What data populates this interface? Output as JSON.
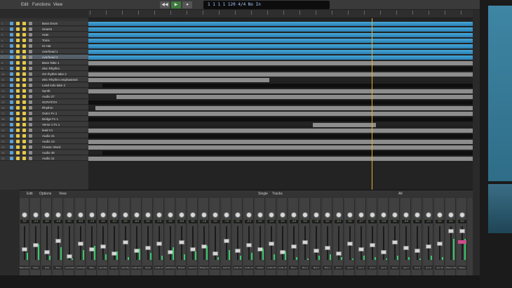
{
  "menu": {
    "edit": "Edit",
    "functions": "Functions",
    "view": "View"
  },
  "lcd": {
    "text": "1 1 1 1   120   4/4   No In"
  },
  "tracks": [
    {
      "num": "1",
      "name": "Bass Drum"
    },
    {
      "num": "2",
      "name": "Snares"
    },
    {
      "num": "3",
      "name": "Hats"
    },
    {
      "num": "4",
      "name": "Toms"
    },
    {
      "num": "5",
      "name": "Hi Hat"
    },
    {
      "num": "6",
      "name": "overhead 1"
    },
    {
      "num": "7",
      "name": "overhead 2"
    },
    {
      "num": "8",
      "name": "Bass Take 1"
    },
    {
      "num": "9",
      "name": "elec Rhythm"
    },
    {
      "num": "10",
      "name": "Gtr rhythm take 2"
    },
    {
      "num": "11",
      "name": "elec Rhythm emphasised"
    },
    {
      "num": "12",
      "name": "Lead solo take 2"
    },
    {
      "num": "13",
      "name": "Synth"
    },
    {
      "num": "14",
      "name": "Audio 27"
    },
    {
      "num": "15",
      "name": "SCRATCH"
    },
    {
      "num": "16",
      "name": "Rhythm"
    },
    {
      "num": "17",
      "name": "Outro Fx 1"
    },
    {
      "num": "18",
      "name": "Bridge Fx 1"
    },
    {
      "num": "19",
      "name": "Verse 1 Fx 1"
    },
    {
      "num": "20",
      "name": "lead V1"
    },
    {
      "num": "21",
      "name": "Audio 41"
    },
    {
      "num": "22",
      "name": "Audio 13"
    },
    {
      "num": "23",
      "name": "Classic Word"
    },
    {
      "num": "24",
      "name": "Audio 46"
    },
    {
      "num": "25",
      "name": "Audio 11"
    }
  ],
  "mixer": {
    "edit": "Edit",
    "options": "Options",
    "view": "View",
    "single": "Single",
    "tracks_btn": "Tracks",
    "all": "All",
    "strips": [
      {
        "val": "0.0",
        "name": "Bass Drum"
      },
      {
        "val": "-2.4",
        "name": "Snare"
      },
      {
        "val": "0.0",
        "name": "Hats"
      },
      {
        "val": "-4.5",
        "name": "Toms"
      },
      {
        "val": "0.0",
        "name": "overhead"
      },
      {
        "val": "-6.0",
        "name": "overhead"
      },
      {
        "val": "-1.2",
        "name": "Bass"
      },
      {
        "val": "0.0",
        "name": "elec Rhy"
      },
      {
        "val": "-3.1",
        "name": "Gtr rhy"
      },
      {
        "val": "0.0",
        "name": "elec Rhy"
      },
      {
        "val": "-8.0",
        "name": "Lead solo"
      },
      {
        "val": "0.0",
        "name": "Synth"
      },
      {
        "val": "-2.0",
        "name": "Audio 27"
      },
      {
        "val": "0.0",
        "name": "SCRATCH"
      },
      {
        "val": "-5.5",
        "name": "Rhythm"
      },
      {
        "val": "0.0",
        "name": "Outro Fx"
      },
      {
        "val": "-1.0",
        "name": "Bridge Fx"
      },
      {
        "val": "0.0",
        "name": "Verse Fx"
      },
      {
        "val": "-7.0",
        "name": "lead V1"
      },
      {
        "val": "0.0",
        "name": "Audio 41"
      },
      {
        "val": "-2.2",
        "name": "Audio 13"
      },
      {
        "val": "0.0",
        "name": "Classic"
      },
      {
        "val": "-3.3",
        "name": "Audio 46"
      },
      {
        "val": "0.0",
        "name": "Audio 11"
      },
      {
        "val": "-4.0",
        "name": "Bus 1"
      },
      {
        "val": "0.0",
        "name": "Bus 2"
      },
      {
        "val": "-1.8",
        "name": "Bus 3"
      },
      {
        "val": "0.0",
        "name": "Bus 4"
      },
      {
        "val": "-6.2",
        "name": "Aux 1"
      },
      {
        "val": "0.0",
        "name": "Aux 2"
      },
      {
        "val": "-2.7",
        "name": "Aux 3"
      },
      {
        "val": "0.0",
        "name": "Aux 4"
      },
      {
        "val": "-0.5",
        "name": "Aux 5"
      },
      {
        "val": "0.0",
        "name": "Aux 6"
      },
      {
        "val": "-3.9",
        "name": "Aux 7"
      },
      {
        "val": "0.0",
        "name": "Aux 8"
      },
      {
        "val": "-1.1",
        "name": "Aux 9"
      },
      {
        "val": "0.0",
        "name": "Aux 10"
      },
      {
        "val": "0.0",
        "name": "Stereo Out"
      },
      {
        "val": "0.0",
        "name": "Master"
      }
    ]
  },
  "colors": {
    "blue_region": "#2f8fc4",
    "gray_region": "#8a8a8a",
    "playhead": "#e2b13a",
    "meter_green": "#39c86a",
    "accent_pink": "#d04a8d"
  }
}
